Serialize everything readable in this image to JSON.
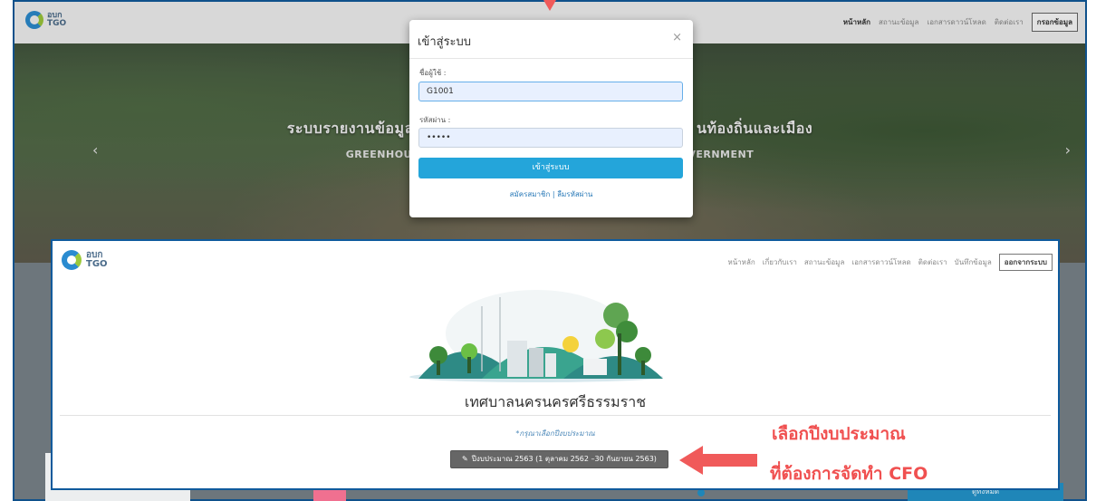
{
  "colors": {
    "accent": "#24a5da",
    "annotation": "#f05050",
    "frame": "#0f5a9c"
  },
  "logo": {
    "line1": "อบก",
    "line2": "TGO"
  },
  "bg_nav": {
    "items": [
      "หน้าหลัก",
      "สถานะข้อมูล",
      "เอกสารดาวน์โหลด",
      "ติดต่อเรา"
    ],
    "button": "กรอกข้อมูล"
  },
  "hero": {
    "title_left": "ระบบรายงานข้อมูล",
    "title_right": "นท้องถิ่นและเมือง",
    "sub_left": "GREENHOU",
    "sub_right": "VERNMENT"
  },
  "login": {
    "title": "เข้าสู่ระบบ",
    "close": "×",
    "username_label": "ชื่อผู้ใช้ :",
    "username_value": "G1001",
    "password_label": "รหัสผ่าน :",
    "password_value": "•••••",
    "submit": "เข้าสู่ระบบ",
    "register": "สมัครสมาชิก",
    "forgot": "ลืมรหัสผ่าน",
    "sep": "|"
  },
  "fg_nav": {
    "items": [
      "หน้าหลัก",
      "เกี่ยวกับเรา",
      "สถานะข้อมูล",
      "เอกสารดาวน์โหลด",
      "ติดต่อเรา",
      "บันทึกข้อมูล"
    ],
    "button": "ออกจากระบบ"
  },
  "fg_main": {
    "org_name": "เทศบาลนครนครศรีธรรมราช",
    "note": "*กรุณาเลือกปีงบประมาณ",
    "year_button": "ปีงบประมาณ 2563 (1 ตุลาคม 2562 –30 กันยายน 2563)"
  },
  "annotation": {
    "line1": "เลือกปีงบประมาณ",
    "line2": "ที่ต้องการจัดทำ CFO"
  },
  "bg_bottom": {
    "right_button": "ดูทั้งหมด"
  }
}
